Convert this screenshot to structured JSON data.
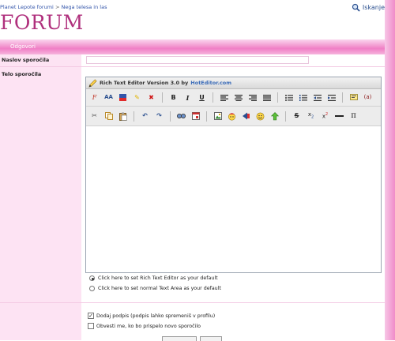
{
  "breadcrumb": {
    "site": "Planet Lepote forumi",
    "separator": ">",
    "section": "Nega telesa in las"
  },
  "search": {
    "label": "Iskanje"
  },
  "logo": {
    "text": "FORUM"
  },
  "nav": {
    "reply_label": "Odgovori"
  },
  "form": {
    "subject_label": "Naslov sporočila",
    "subject_value": "",
    "body_label": "Telo sporočila"
  },
  "editor": {
    "title": "Rich Text Editor Version 3.0 by",
    "brand": "HotEditor.com",
    "toolbar_row1": [
      {
        "name": "font-face-icon",
        "glyph": "ℱ"
      },
      {
        "name": "font-size-icon",
        "glyph": "ᴬA"
      },
      {
        "name": "font-color-icon",
        "glyph": "▆"
      },
      {
        "name": "highlight-icon",
        "glyph": "✎"
      },
      {
        "name": "remove-format-icon",
        "glyph": "✖"
      },
      {
        "name": "bold-icon",
        "glyph": "B"
      },
      {
        "name": "italic-icon",
        "glyph": "I"
      },
      {
        "name": "underline-icon",
        "glyph": "U"
      },
      {
        "name": "align-left-icon",
        "glyph": "≡"
      },
      {
        "name": "align-center-icon",
        "glyph": "≡"
      },
      {
        "name": "align-right-icon",
        "glyph": "≡"
      },
      {
        "name": "justify-icon",
        "glyph": "≡"
      },
      {
        "name": "bullet-list-icon",
        "glyph": "☰"
      },
      {
        "name": "numbered-list-icon",
        "glyph": "☷"
      },
      {
        "name": "outdent-icon",
        "glyph": "⇤"
      },
      {
        "name": "indent-icon",
        "glyph": "⇥"
      },
      {
        "name": "comment-icon",
        "glyph": "▤"
      },
      {
        "name": "copyright-icon",
        "glyph": "(a)"
      }
    ],
    "toolbar_row2": [
      {
        "name": "cut-icon",
        "glyph": "✂"
      },
      {
        "name": "copy-icon",
        "glyph": "❐"
      },
      {
        "name": "paste-icon",
        "glyph": "📋"
      },
      {
        "name": "undo-icon",
        "glyph": "↶"
      },
      {
        "name": "redo-icon",
        "glyph": "↷"
      },
      {
        "name": "find-icon",
        "glyph": "⌕"
      },
      {
        "name": "calendar-icon",
        "glyph": "▦"
      },
      {
        "name": "image-icon",
        "glyph": "▣"
      },
      {
        "name": "emoticon-icon",
        "glyph": "☻"
      },
      {
        "name": "link-icon",
        "glyph": "◀"
      },
      {
        "name": "smiley-icon",
        "glyph": "☺"
      },
      {
        "name": "upload-icon",
        "glyph": "⇪"
      },
      {
        "name": "strikethrough-icon",
        "glyph": "S"
      },
      {
        "name": "subscript-icon",
        "glyph": "x₂"
      },
      {
        "name": "superscript-icon",
        "glyph": "x²"
      },
      {
        "name": "horizontal-rule-icon",
        "glyph": "—"
      },
      {
        "name": "special-char-icon",
        "glyph": "π"
      }
    ],
    "content": ""
  },
  "options": {
    "rich_default": "Click here to set Rich Text Editor as your default",
    "plain_default": "Click here to set normal Text Area as your default",
    "add_signature": "Dodaj podpis (podpis lahko spremeniš v profilu)",
    "notify_reply": "Obvesti me, ko bo prispelo novo sporočilo"
  },
  "colors": {
    "accent": "#b0307d",
    "nav_pink": "#f07fc6",
    "side_pink": "#fde3f3"
  }
}
